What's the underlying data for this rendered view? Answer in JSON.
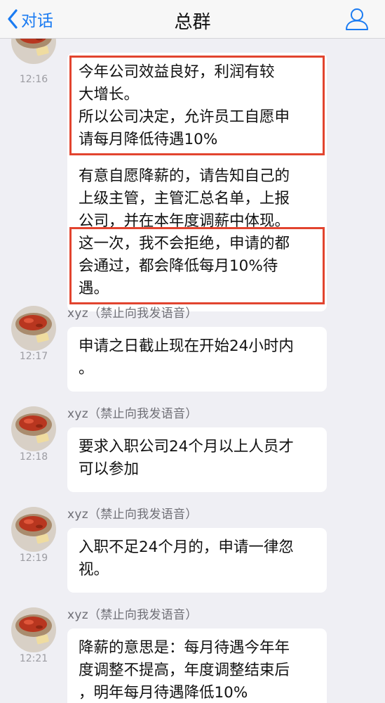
{
  "nav": {
    "back_label": "对话",
    "title": "总群",
    "profile_icon": "person-outline-icon"
  },
  "colors": {
    "accent": "#1a7bf2",
    "highlight": "#e2442f",
    "background": "#efeff4",
    "bubble": "#ffffff"
  },
  "messages": [
    {
      "time": "12:16",
      "sender": "",
      "paragraphs": [
        [
          "今年公司效益良好，利润有较",
          "大增长。",
          "所以公司决定，允许员工自愿申",
          "请每月降低待遇10%"
        ],
        [
          "有意自愿降薪的，请告知自己的",
          "上级主管，主管汇总名单，上报",
          "公司，并在本年度调薪中体现。",
          "这一次，我不会拒绝，申请的都",
          "会通过，都会降低每月10%待",
          "遇。"
        ]
      ]
    },
    {
      "time": "12:17",
      "sender": "xyz（禁止向我发语音）",
      "paragraphs": [
        [
          "申请之日截止现在开始24小时内",
          "。"
        ]
      ]
    },
    {
      "time": "12:18",
      "sender": "xyz（禁止向我发语音）",
      "paragraphs": [
        [
          "要求入职公司24个月以上人员才",
          "可以参加"
        ]
      ]
    },
    {
      "time": "12:19",
      "sender": "xyz（禁止向我发语音）",
      "paragraphs": [
        [
          "入职不足24个月的，申请一律忽",
          "视。"
        ]
      ]
    },
    {
      "time": "12:21",
      "sender": "xyz（禁止向我发语音）",
      "paragraphs": [
        [
          "降薪的意思是：每月待遇今年年",
          "度调整不提高，年度调整结束后",
          "，明年每月待遇降低10%"
        ]
      ]
    }
  ]
}
